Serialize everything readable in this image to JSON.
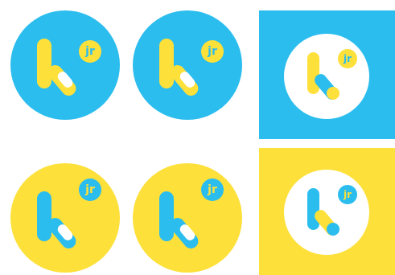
{
  "colors": {
    "blue": "#2bbdee",
    "yellow": "#fde03a",
    "white": "#ffffff"
  },
  "logo": {
    "badge_text": "jr",
    "mark": "k"
  },
  "variants": [
    {
      "id": "circle-blue-1",
      "background": "blue",
      "letter": "yellow",
      "badge": "yellow"
    },
    {
      "id": "circle-blue-2",
      "background": "blue",
      "letter": "yellow",
      "badge": "yellow"
    },
    {
      "id": "square-blue-white-circle",
      "background": "blue",
      "inner": "white",
      "letter": "yellow",
      "badge": "yellow"
    },
    {
      "id": "circle-yellow-1",
      "background": "yellow",
      "letter": "blue",
      "badge": "blue"
    },
    {
      "id": "circle-yellow-2",
      "background": "yellow",
      "letter": "blue",
      "badge": "blue"
    },
    {
      "id": "square-yellow-white-circle",
      "background": "yellow",
      "inner": "white",
      "letter": "blue",
      "badge": "blue"
    }
  ]
}
